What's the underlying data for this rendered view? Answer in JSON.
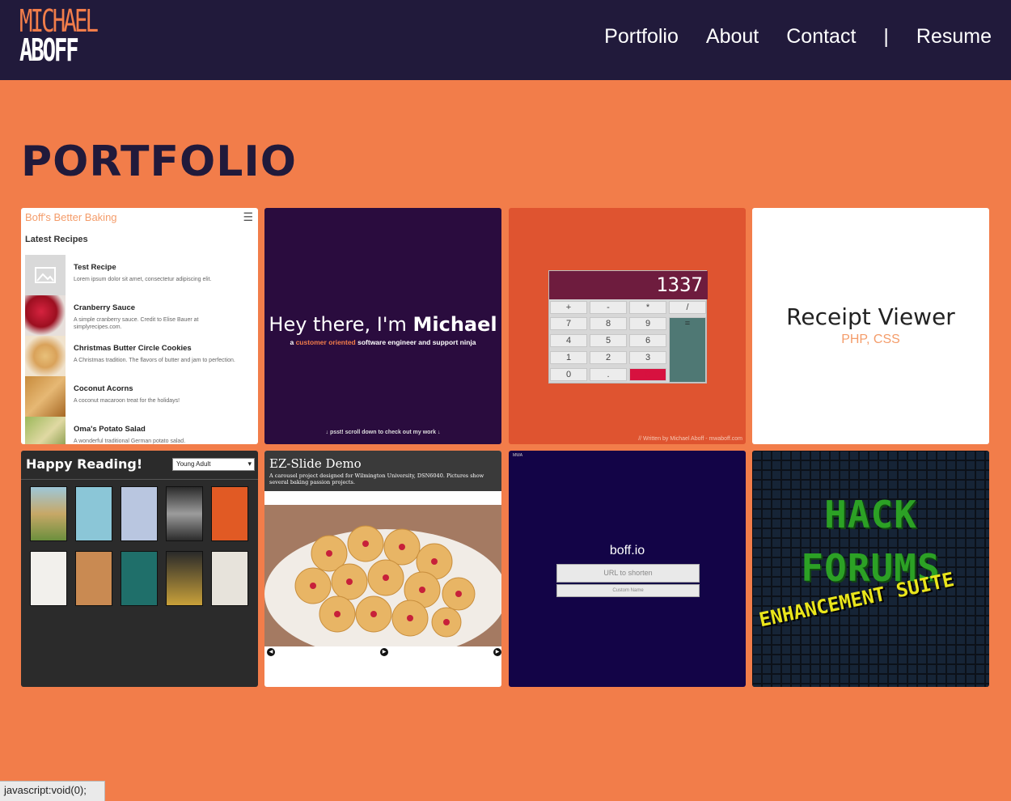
{
  "nav": {
    "logo_top": "MICHAEL",
    "logo_bottom": "ABOFF",
    "links": [
      "Portfolio",
      "About",
      "Contact",
      "|",
      "Resume"
    ]
  },
  "page_title": "PORTFOLIO",
  "cards": {
    "baking": {
      "title": "Boff's Better Baking",
      "menu_icon": "hamburger-icon",
      "section": "Latest Recipes",
      "recipes": [
        {
          "name": "Test Recipe",
          "desc": "Lorem ipsum dolor sit amet, consectetur adipiscing elit."
        },
        {
          "name": "Cranberry Sauce",
          "desc": "A simple cranberry sauce. Credit to Elise Bauer at simplyrecipes.com."
        },
        {
          "name": "Christmas Butter Circle Cookies",
          "desc": "A Christmas tradition. The flavors of butter and jam to perfection."
        },
        {
          "name": "Coconut Acorns",
          "desc": "A coconut macaroon treat for the holidays!"
        },
        {
          "name": "Oma's Potato Salad",
          "desc": "A wonderful traditional German potato salad."
        }
      ]
    },
    "intro": {
      "greeting": "Hey there, I'm",
      "name": "Michael",
      "sub_a": "a",
      "sub_highlight": "customer oriented",
      "sub_b": "software engineer and support ninja",
      "psst": "↓ psst! scroll down to check out my work ↓"
    },
    "calculator": {
      "display": "1337",
      "keys": [
        "+",
        "-",
        "*",
        "/",
        "7",
        "8",
        "9",
        "=",
        "4",
        "5",
        "6",
        "1",
        "2",
        "3",
        "0",
        ".",
        "C"
      ],
      "footer": "// Written by Michael Aboff - mwaboff.com"
    },
    "receipt": {
      "title": "Receipt Viewer",
      "tech": "PHP, CSS"
    },
    "reading": {
      "title": "Happy Reading!",
      "select": "Young Adult"
    },
    "ezslide": {
      "title": "EZ-Slide Demo",
      "desc": "A carousel project designed for Wilmington University, DSN6040. Pictures show several baking passion projects."
    },
    "boff": {
      "corner": "MWA",
      "title": "boff.io",
      "input1": "URL to shorten",
      "input2": "Custom Name"
    },
    "hack": {
      "line1": "HACK",
      "line2": "FORUMS",
      "line3": "ENHANCEMENT SUITE"
    }
  },
  "status_bar": "javascript:void(0);",
  "colors": {
    "nav_bg": "#211a3b",
    "page_bg": "#f27d4a",
    "accent": "#f27d4a"
  }
}
